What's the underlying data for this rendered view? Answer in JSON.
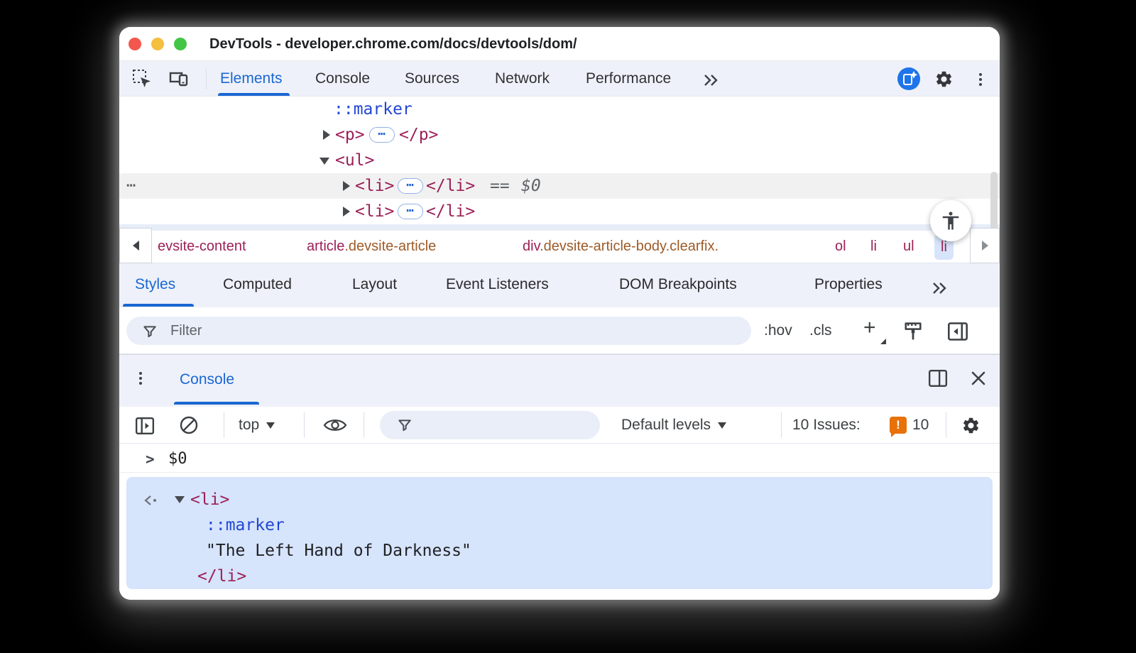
{
  "titlebar": {
    "title": "DevTools - developer.chrome.com/docs/devtools/dom/"
  },
  "tabs": {
    "items": [
      "Elements",
      "Console",
      "Sources",
      "Network",
      "Performance"
    ]
  },
  "dom": {
    "handle": "⋯",
    "ellipsis": "⋯",
    "marker_row": {
      "label": "::marker"
    },
    "p_row": {
      "open": "<p>",
      "close": "</p>"
    },
    "ul_row": {
      "open": "<ul>"
    },
    "li1_row": {
      "open": "<li>",
      "close": "</li>",
      "eq": "==",
      "dollar": "$0"
    },
    "li2_row": {
      "open": "<li>",
      "close": "</li>"
    }
  },
  "crumbs": {
    "items": [
      {
        "tag": "evsite-content",
        "cls": ""
      },
      {
        "tag": "article",
        "cls": ".devsite-article"
      },
      {
        "tag": "div",
        "cls": ".devsite-article-body.clearfix."
      },
      {
        "tag": "ol",
        "cls": ""
      },
      {
        "tag": "li",
        "cls": ""
      },
      {
        "tag": "ul",
        "cls": ""
      },
      {
        "tag": "li",
        "cls": ""
      }
    ]
  },
  "sidebar": {
    "tabs": [
      "Styles",
      "Computed",
      "Layout",
      "Event Listeners",
      "DOM Breakpoints",
      "Properties"
    ],
    "filter_placeholder": "Filter",
    "hov": ":hov",
    "cls": ".cls",
    "plus": "+"
  },
  "drawer": {
    "tab": "Console"
  },
  "console_toolbar": {
    "context": "top",
    "levels": "Default levels",
    "issues_label": "10 Issues:",
    "issues_icon": "!",
    "issues_count": "10"
  },
  "console": {
    "prompt": ">",
    "command": "$0",
    "result": {
      "open": "<li>",
      "marker": "::marker",
      "string": "\"The Left Hand of Darkness\"",
      "close": "</li>"
    }
  }
}
